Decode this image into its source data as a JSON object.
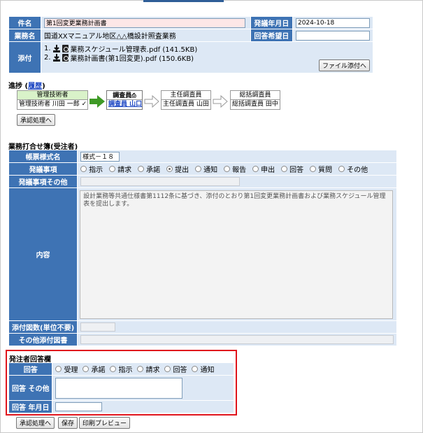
{
  "header": {
    "subject_label": "件名",
    "subject_value": "第1回変更業務計画書",
    "issue_date_label": "発議年月日",
    "issue_date_value": "2024-10-18",
    "work_name_label": "業務名",
    "work_name_value": "国道XXマニュアル地区△△橋設計照査業務",
    "reply_wish_label": "回答希望日",
    "reply_wish_value": "",
    "attach_label": "添付",
    "files": [
      {
        "index": "1.",
        "name": "業務スケジュール管理表.pdf (141.5KB)"
      },
      {
        "index": "2.",
        "name": "業務計画書(第1回変更).pdf (150.6KB)"
      }
    ],
    "attach_button": "ファイル添付へ"
  },
  "progress": {
    "label": "進捗",
    "history_open": "(",
    "history_link": "履歴",
    "history_close": ")",
    "steps": [
      {
        "role": "管理技術者",
        "person": "管理技術者 川田 一郎 ✓"
      },
      {
        "role": "調査員",
        "person": "調査員 山口"
      },
      {
        "role": "主任調査員",
        "person": "主任調査員 山田"
      },
      {
        "role": "総括調査員",
        "person": "総括調査員 田中"
      }
    ],
    "approve_button": "承認処理へ"
  },
  "form": {
    "title": "業務打合せ簿(受注者)",
    "form_no_label": "帳票様式名",
    "form_no_value": "様式－１８",
    "item_label": "発議事項",
    "items": [
      "指示",
      "請求",
      "承諾",
      "提出",
      "通知",
      "報告",
      "申出",
      "回答",
      "質問",
      "その他"
    ],
    "item_selected": "提出",
    "item_other_label": "発議事項その他",
    "content_label": "内容",
    "content_text": "設計業務等共通仕様書第1112条に基づき、添付のとおり第1回変更業務計画書および業務スケジュール管理表を提出します。",
    "attach_count_label": "添付図数(単位不要)",
    "attach_other_label": "その他添付図書"
  },
  "answer": {
    "title": "発注者回答欄",
    "answer_label": "回答",
    "options": [
      "受理",
      "承諾",
      "指示",
      "請求",
      "回答",
      "通知"
    ],
    "other_label": "回答 その他",
    "date_label": "回答 年月日"
  },
  "footer": {
    "approve_button": "承認処理へ",
    "save_button": "保存",
    "preview_button": "印刷プレビュー"
  },
  "colors": {
    "header_blue": "#3e73b4",
    "cell_blue": "#dde8f5",
    "highlight_red": "#e0141c",
    "arrow_green": "#3f9a26"
  }
}
